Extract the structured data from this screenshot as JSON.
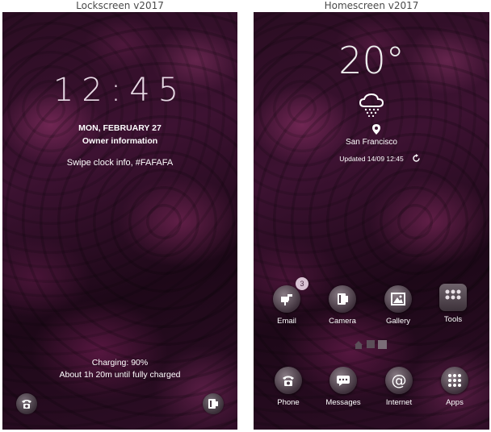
{
  "captions": {
    "lock": "Lockscreen v2017",
    "home": "Homescreen v2017"
  },
  "lockscreen": {
    "time": "12:45",
    "date": "MON, FEBRUARY 27",
    "owner": "Owner information",
    "swipe_info": "Swipe clock info, #FAFAFA",
    "charging": "Charging: 90%",
    "charge_remaining": "About 1h 20m until fully charged",
    "left_shortcut_icon": "phone-icon",
    "right_shortcut_icon": "camera-icon"
  },
  "homescreen": {
    "weather": {
      "temperature": "20°",
      "icon": "snow-cloud-icon",
      "city": "San Francisco",
      "updated": "Updated 14/09 12:45"
    },
    "apps_row1": [
      {
        "label": "Email",
        "icon": "email-icon",
        "badge": "3"
      },
      {
        "label": "Camera",
        "icon": "camera-icon"
      },
      {
        "label": "Gallery",
        "icon": "gallery-icon"
      },
      {
        "label": "Tools",
        "icon": "tools-folder-icon"
      }
    ],
    "apps_row2": [
      {
        "label": "Phone",
        "icon": "phone-icon"
      },
      {
        "label": "Messages",
        "icon": "messages-icon"
      },
      {
        "label": "Internet",
        "icon": "internet-icon"
      },
      {
        "label": "Apps",
        "icon": "apps-icon"
      }
    ]
  },
  "colors": {
    "accent_text": "#ffffff",
    "badge_bg": "#d7c1d2",
    "background": "#2a0d22"
  }
}
